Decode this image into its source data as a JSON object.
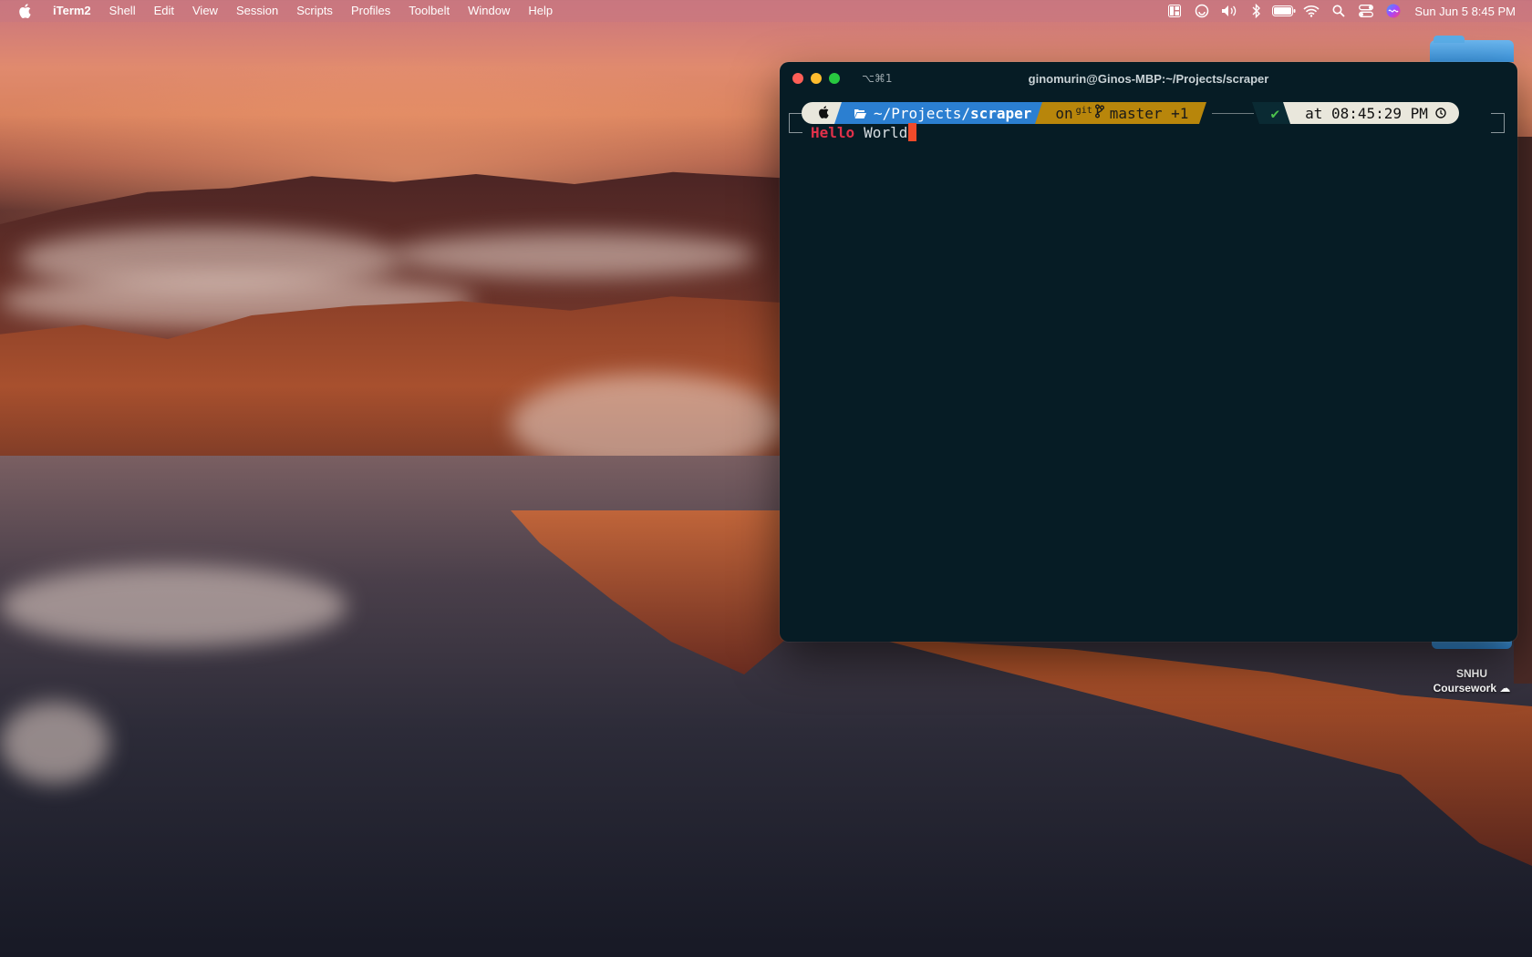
{
  "menubar": {
    "apple_icon": "apple-logo",
    "app_name": "iTerm2",
    "items": [
      "Shell",
      "Edit",
      "View",
      "Session",
      "Scripts",
      "Profiles",
      "Toolbelt",
      "Window",
      "Help"
    ],
    "status_icons": [
      "layout-icon",
      "focus-icon",
      "volume-icon",
      "bluetooth-icon",
      "battery-icon",
      "wifi-icon",
      "search-icon",
      "control-center-icon",
      "siri-icon"
    ],
    "clock": "Sun Jun 5  8:45 PM"
  },
  "terminal": {
    "tab_shortcut": "⌥⌘1",
    "title": "ginomurin@Ginos-MBP:~/Projects/scraper",
    "prompt": {
      "os_icon": "apple-logo",
      "path_prefix": "~/Projects/",
      "path_dir": "scraper",
      "vcs_on": "on",
      "vcs_git": "git",
      "branch": "master +1",
      "status_ok": "✔",
      "time": "at 08:45:29 PM"
    },
    "command": {
      "word1": "Hello",
      "word2": "World"
    }
  },
  "desktop": {
    "folder_label_line1": "SNHU",
    "folder_label_line2": "Coursework"
  },
  "colors": {
    "terminal_bg": "#061c25",
    "path_segment": "#2b7fd1",
    "git_segment": "#b8860b",
    "hello_red": "#e0314a",
    "cursor": "#f04a2a"
  }
}
